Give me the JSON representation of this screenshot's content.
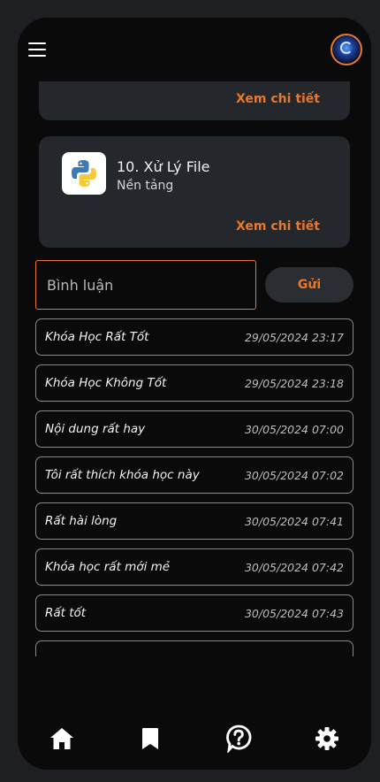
{
  "header": {
    "menu_icon": "hamburger-menu-icon",
    "avatar_icon": "user-avatar"
  },
  "courses": [
    {
      "detail_label": "Xem chi tiết"
    },
    {
      "title": "10. Xử Lý File",
      "subtitle": "Nền tảng",
      "icon": "python-logo-icon",
      "detail_label": "Xem chi tiết"
    }
  ],
  "comment_form": {
    "placeholder": "Bình luận",
    "value": "",
    "send_label": "Gửi"
  },
  "comments": [
    {
      "text": "Khóa Học Rất Tốt",
      "time": "29/05/2024 23:17"
    },
    {
      "text": "Khóa Học Không Tốt",
      "time": "29/05/2024 23:18"
    },
    {
      "text": "Nội dung rất hay",
      "time": "30/05/2024 07:00"
    },
    {
      "text": "Tôi rất thích khóa học này",
      "time": "30/05/2024 07:02"
    },
    {
      "text": "Rất hài lòng",
      "time": "30/05/2024 07:41"
    },
    {
      "text": "Khóa học rất mới mẻ",
      "time": "30/05/2024 07:42"
    },
    {
      "text": "Rất tốt",
      "time": "30/05/2024 07:43"
    }
  ],
  "bottom_nav": [
    {
      "icon": "home-icon"
    },
    {
      "icon": "bookmark-icon"
    },
    {
      "icon": "help-icon"
    },
    {
      "icon": "settings-icon"
    }
  ],
  "colors": {
    "accent": "#e8782c",
    "background": "#0b0a0a",
    "card": "#24272c"
  }
}
